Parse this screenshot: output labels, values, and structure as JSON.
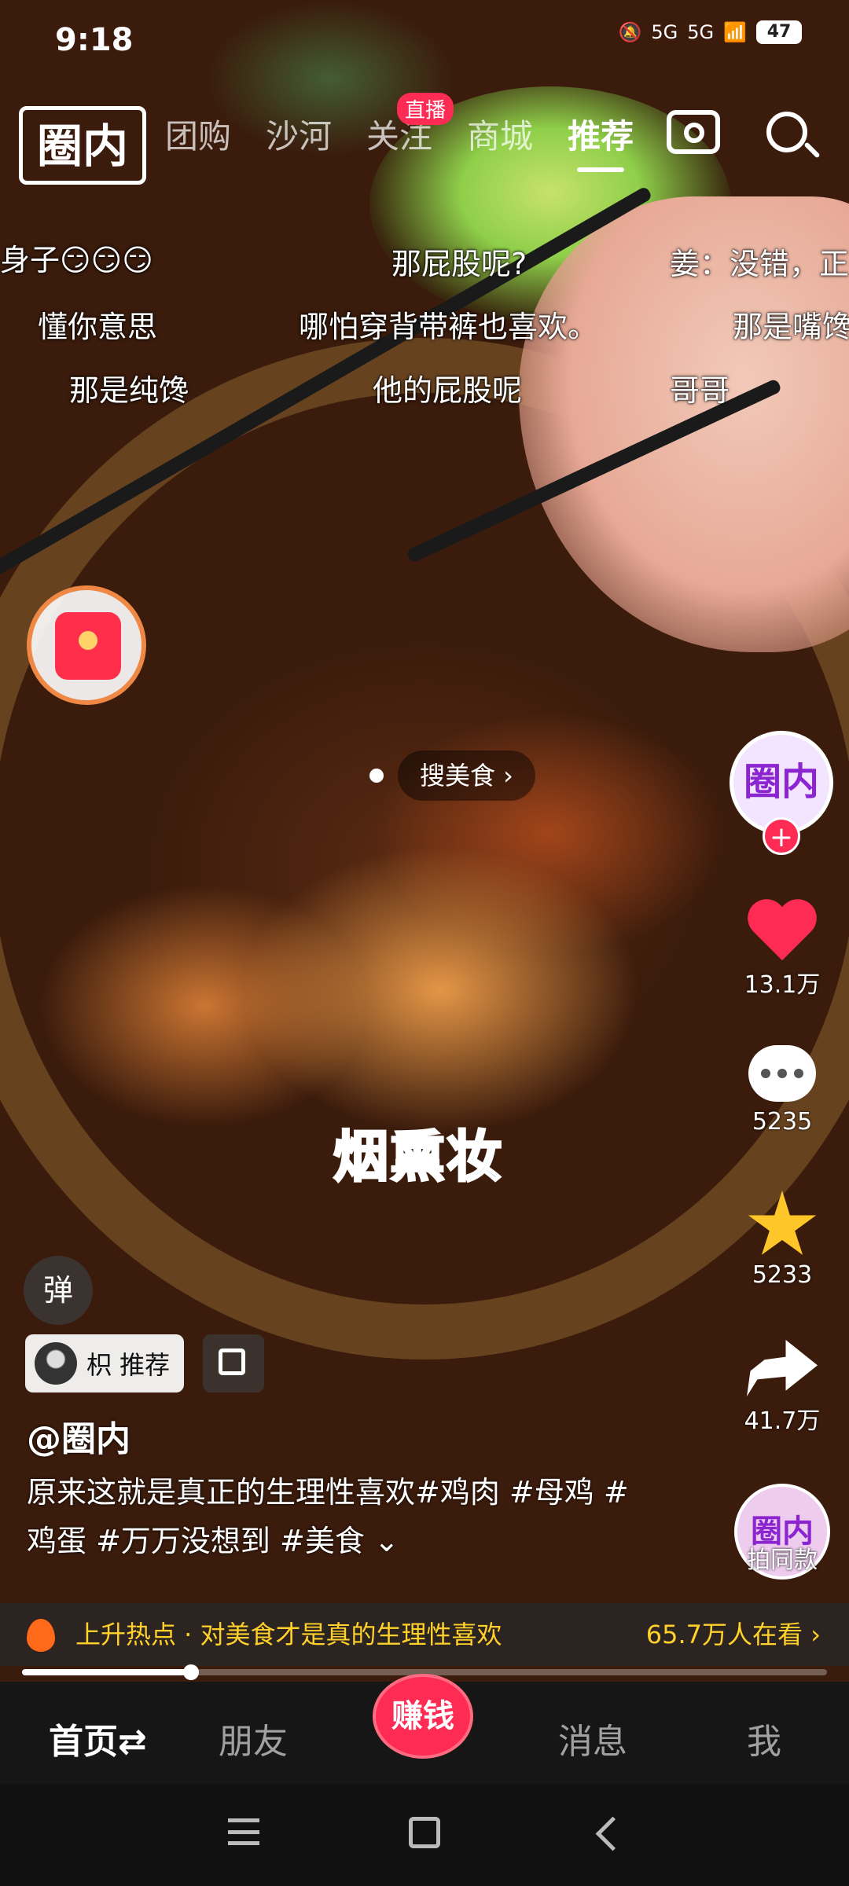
{
  "status_bar": {
    "time": "9:18",
    "signal1": "5G",
    "signal2": "5G",
    "battery": "47"
  },
  "top_nav": {
    "logo_text": "圈内",
    "tabs": [
      {
        "label": "团购"
      },
      {
        "label": "沙河"
      },
      {
        "label": "关注"
      },
      {
        "label": "商城"
      },
      {
        "label": "推荐"
      }
    ],
    "active_tab": "推荐",
    "live_badge": "直播",
    "icons": [
      "camera-icon",
      "search-icon"
    ]
  },
  "danmaku": [
    "身子😏😏😏",
    "那屁股呢?",
    "姜：没错，正",
    "懂你意思",
    "哪怕穿背带裤也喜欢。",
    "那是嘴馋",
    "那是纯馋",
    "他的屁股呢",
    "哥哥"
  ],
  "search_pill": {
    "label": "搜美食 ›"
  },
  "overlay_caption": "烟熏妆",
  "right_rail": {
    "avatar_text": "圈内",
    "follow_symbol": "+",
    "likes": "13.1万",
    "comments": "5235",
    "favorites": "5233",
    "shares": "41.7万",
    "remix_avatar_text": "圈内",
    "remix_label": "拍同款"
  },
  "video_info": {
    "danmu_toggle": "弹",
    "recommend_chip": "枳 推荐",
    "author": "@圈内",
    "description": "原来这就是真正的生理性喜欢#鸡肉 #母鸡 #鸡蛋 #万万没想到 #美食 ⌄"
  },
  "hot_bar": {
    "text": "上升热点 · 对美食才是真的生理性喜欢",
    "watching": "65.7万人在看 ›"
  },
  "progress": {
    "fraction": 0.21
  },
  "tab_bar": {
    "home": "首页⇄",
    "friends": "朋友",
    "earn": "赚钱",
    "messages": "消息",
    "me": "我"
  },
  "colors": {
    "accent": "#fe2c55",
    "hot": "#ffd12a",
    "caption": "#1e7bd8"
  }
}
